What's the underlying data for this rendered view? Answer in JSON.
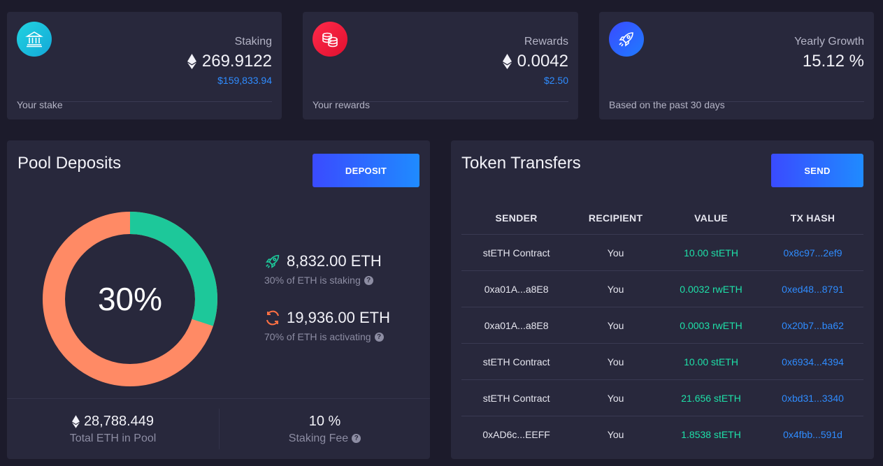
{
  "stats": [
    {
      "label": "Staking",
      "value": "269.9122",
      "usd": "$159,833.94",
      "footer": "Your stake",
      "icon": "bank-icon",
      "color": "#19c9d8"
    },
    {
      "label": "Rewards",
      "value": "0.0042",
      "usd": "$2.50",
      "footer": "Your rewards",
      "icon": "coins-icon",
      "color": "#f0163d"
    },
    {
      "label": "Yearly Growth",
      "value": "15.12 %",
      "usd": "",
      "footer": "Based on the past 30 days",
      "icon": "rocket-icon",
      "color": "#2f5cff"
    }
  ],
  "pool": {
    "title": "Pool Deposits",
    "deposit_label": "DEPOSIT",
    "center_label": "30%",
    "staking_fraction": 0.3,
    "colors": {
      "staking": "#1dc89a",
      "activating": "#ff8a65"
    },
    "staking_amount": "8,832.00 ETH",
    "staking_sub": "30% of ETH is staking",
    "activating_amount": "19,936.00 ETH",
    "activating_sub": "70% of ETH is activating",
    "total_value": "28,788.449",
    "total_label": "Total ETH in Pool",
    "fee_value": "10 %",
    "fee_label": "Staking Fee"
  },
  "transfers": {
    "title": "Token Transfers",
    "send_label": "SEND",
    "headers": [
      "SENDER",
      "RECIPIENT",
      "VALUE",
      "TX HASH"
    ],
    "rows": [
      {
        "sender": "stETH Contract",
        "recipient": "You",
        "value": "10.00 stETH",
        "hash": "0x8c97...2ef9"
      },
      {
        "sender": "0xa01A...a8E8",
        "recipient": "You",
        "value": "0.0032 rwETH",
        "hash": "0xed48...8791"
      },
      {
        "sender": "0xa01A...a8E8",
        "recipient": "You",
        "value": "0.0003 rwETH",
        "hash": "0x20b7...ba62"
      },
      {
        "sender": "stETH Contract",
        "recipient": "You",
        "value": "10.00 stETH",
        "hash": "0x6934...4394"
      },
      {
        "sender": "stETH Contract",
        "recipient": "You",
        "value": "21.656 stETH",
        "hash": "0xbd31...3340"
      },
      {
        "sender": "0xAD6c...EEFF",
        "recipient": "You",
        "value": "1.8538 stETH",
        "hash": "0x4fbb...591d"
      }
    ]
  }
}
